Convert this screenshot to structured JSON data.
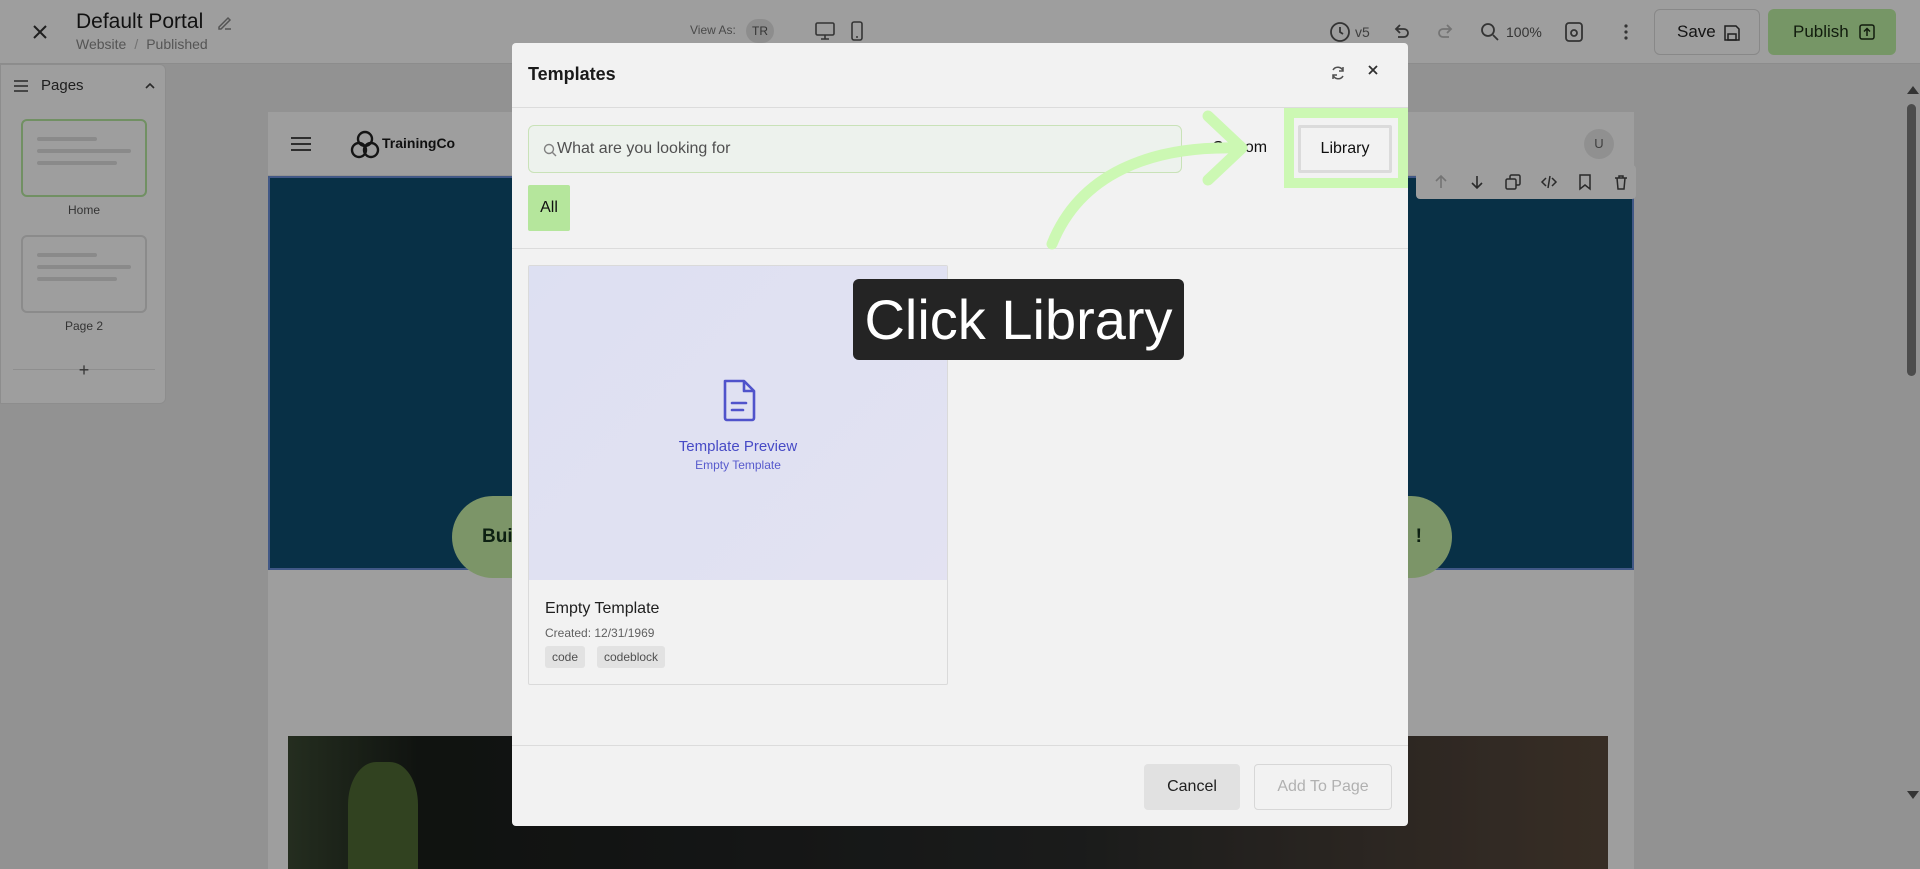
{
  "topbar": {
    "title": "Default Portal",
    "breadcrumb": [
      "Website",
      "Published"
    ],
    "view_as_label": "View As:",
    "view_as_value": "TR",
    "version": "v5",
    "zoom": "100%",
    "save_label": "Save",
    "publish_label": "Publish"
  },
  "pages_panel": {
    "title": "Pages",
    "pages": [
      {
        "label": "Home",
        "active": true
      },
      {
        "label": "Page 2",
        "active": false
      }
    ],
    "add_label": "+"
  },
  "site": {
    "brand": "TrainingCo",
    "avatar_initial": "U",
    "hero_button_left": "Buil",
    "hero_button_right": "!"
  },
  "modal": {
    "title": "Templates",
    "search_placeholder": "What are you looking for",
    "tab_custom": "Custom",
    "tab_library": "Library",
    "filter_all": "All",
    "template": {
      "preview_title": "Template Preview",
      "preview_subtitle": "Empty Template",
      "name": "Empty Template",
      "created": "Created: 12/31/1969",
      "tags": [
        "code",
        "codeblock"
      ]
    },
    "cancel_label": "Cancel",
    "add_label": "Add To Page"
  },
  "guide": {
    "tooltip": "Click Library"
  },
  "colors": {
    "accent_green": "#bff3a5",
    "highlight_green": "#ccf8b3",
    "hero_blue": "#0e4e72",
    "tooltip_bg": "#242424",
    "preview_purple": "#4b4fd1"
  },
  "icons": {
    "close": "close-icon",
    "edit": "pencil-icon",
    "desktop": "desktop-icon",
    "mobile": "mobile-icon",
    "history": "clock-icon",
    "undo": "undo-icon",
    "redo": "redo-icon",
    "zoom": "search-icon",
    "preview": "preview-icon",
    "more": "more-vertical-icon",
    "save": "floppy-disk-icon",
    "publish": "upload-icon"
  }
}
